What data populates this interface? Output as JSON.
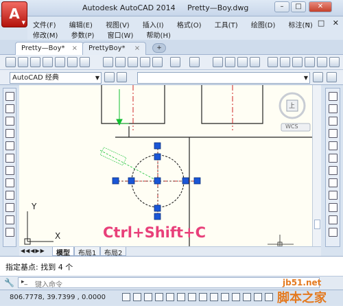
{
  "app": {
    "logo_letter": "A",
    "title_app": "Autodesk AutoCAD 2014",
    "title_file": "Pretty—Boy.dwg"
  },
  "menu": {
    "row1": [
      "文件(F)",
      "编辑(E)",
      "视图(V)",
      "插入(I)",
      "格式(O)",
      "工具(T)",
      "绘图(D)",
      "标注(N)"
    ],
    "row2": [
      "修改(M)",
      "参数(P)",
      "窗口(W)",
      "帮助(H)"
    ]
  },
  "tabs": [
    {
      "label": "Pretty—Boy*",
      "close": "×"
    },
    {
      "label": "PrettyBoy*",
      "close": "×"
    }
  ],
  "workspace": {
    "value": "AutoCAD 经典"
  },
  "viewcube": {
    "label": "WCS",
    "face": "上"
  },
  "ucs": {
    "y": "Y",
    "x": "X"
  },
  "layout_tabs": [
    "模型",
    "布局1",
    "布局2"
  ],
  "caption": "Ctrl+Shift+C",
  "command": {
    "history": "指定基点:  找到 4 个",
    "prompt_icon": "▸_",
    "placeholder": "键入命令"
  },
  "status": {
    "coords": "806.7778, 39.7399 , 0.0000"
  },
  "watermark": {
    "line1": "jb51.net",
    "line2": "脚本之家"
  },
  "colors": {
    "grip": "#1a56d6",
    "centerline": "#cc2222",
    "dimension": "#10c030",
    "caption": "#e8407a"
  }
}
